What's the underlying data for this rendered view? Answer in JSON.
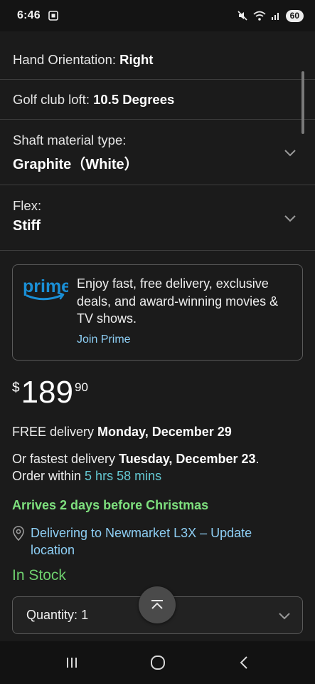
{
  "status_bar": {
    "time": "6:46",
    "battery": "60",
    "icons": [
      "screenshot-icon",
      "mute-icon",
      "wifi-icon",
      "signal-icon"
    ]
  },
  "variations": [
    {
      "label": "Hand Orientation:",
      "value": "Right"
    },
    {
      "label": "Golf club loft:",
      "value": "10.5 Degrees"
    },
    {
      "label": "Shaft material type:",
      "value": "Graphite（White）"
    },
    {
      "label": "Flex:",
      "value": "Stiff"
    }
  ],
  "prime": {
    "logo_text": "prime",
    "message": "Enjoy fast, free delivery, exclusive deals, and award-winning movies & TV shows.",
    "link": "Join Prime",
    "brand_color": "#1a8fd6"
  },
  "price": {
    "currency": "$",
    "whole": "189",
    "fraction": "90"
  },
  "delivery": {
    "free_prefix": "FREE delivery",
    "free_date": "Monday, December 29",
    "fast_prefix": "Or fastest delivery",
    "fast_date": "Tuesday, December 23",
    "fast_suffix": ".",
    "order_prefix": "Order within",
    "order_time": "5 hrs 58 mins",
    "christmas": "Arrives 2 days before Christmas",
    "location": "Delivering to Newmarket L3X – Update location"
  },
  "stock": "In Stock",
  "quantity": {
    "label": "Quantity:",
    "value": "1"
  },
  "colors": {
    "link": "#8ecff5",
    "teal": "#64c9d3",
    "green": "#7ee07e"
  }
}
